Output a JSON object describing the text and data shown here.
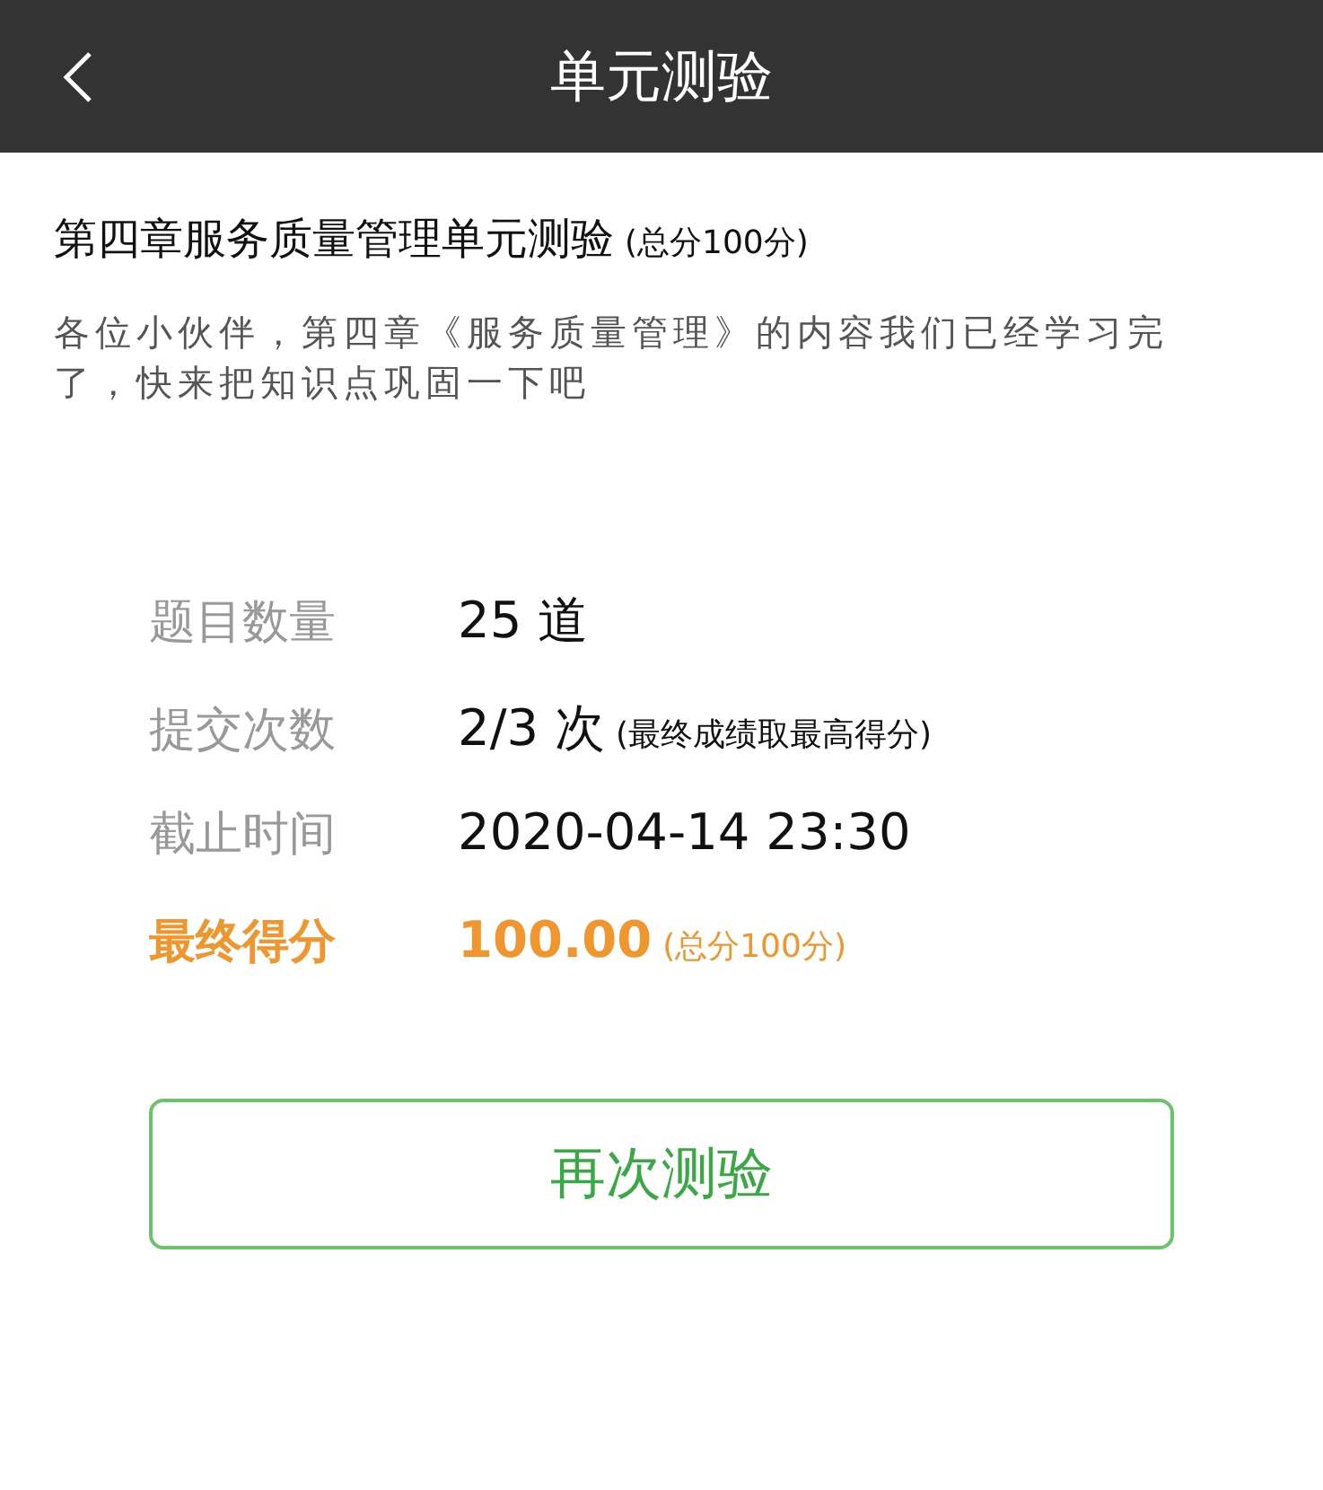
{
  "header": {
    "title": "单元测验"
  },
  "quiz": {
    "title": "第四章服务质量管理单元测验",
    "total_note": "(总分100分)",
    "description": "各位小伙伴，第四章《服务质量管理》的内容我们已经学习完了，快来把知识点巩固一下吧"
  },
  "info_rows": [
    {
      "kind": "plain",
      "label": "题目数量",
      "value": "25 道"
    },
    {
      "kind": "plain",
      "label": "提交次数",
      "value": "2/3 次",
      "note": "(最终成绩取最高得分)"
    },
    {
      "kind": "plain",
      "label": "截止时间",
      "value": "2020-04-14 23:30"
    },
    {
      "kind": "highlight",
      "label": "最终得分",
      "value": "100.00",
      "note": "(总分100分)"
    }
  ],
  "button": {
    "label": "再次测验"
  }
}
